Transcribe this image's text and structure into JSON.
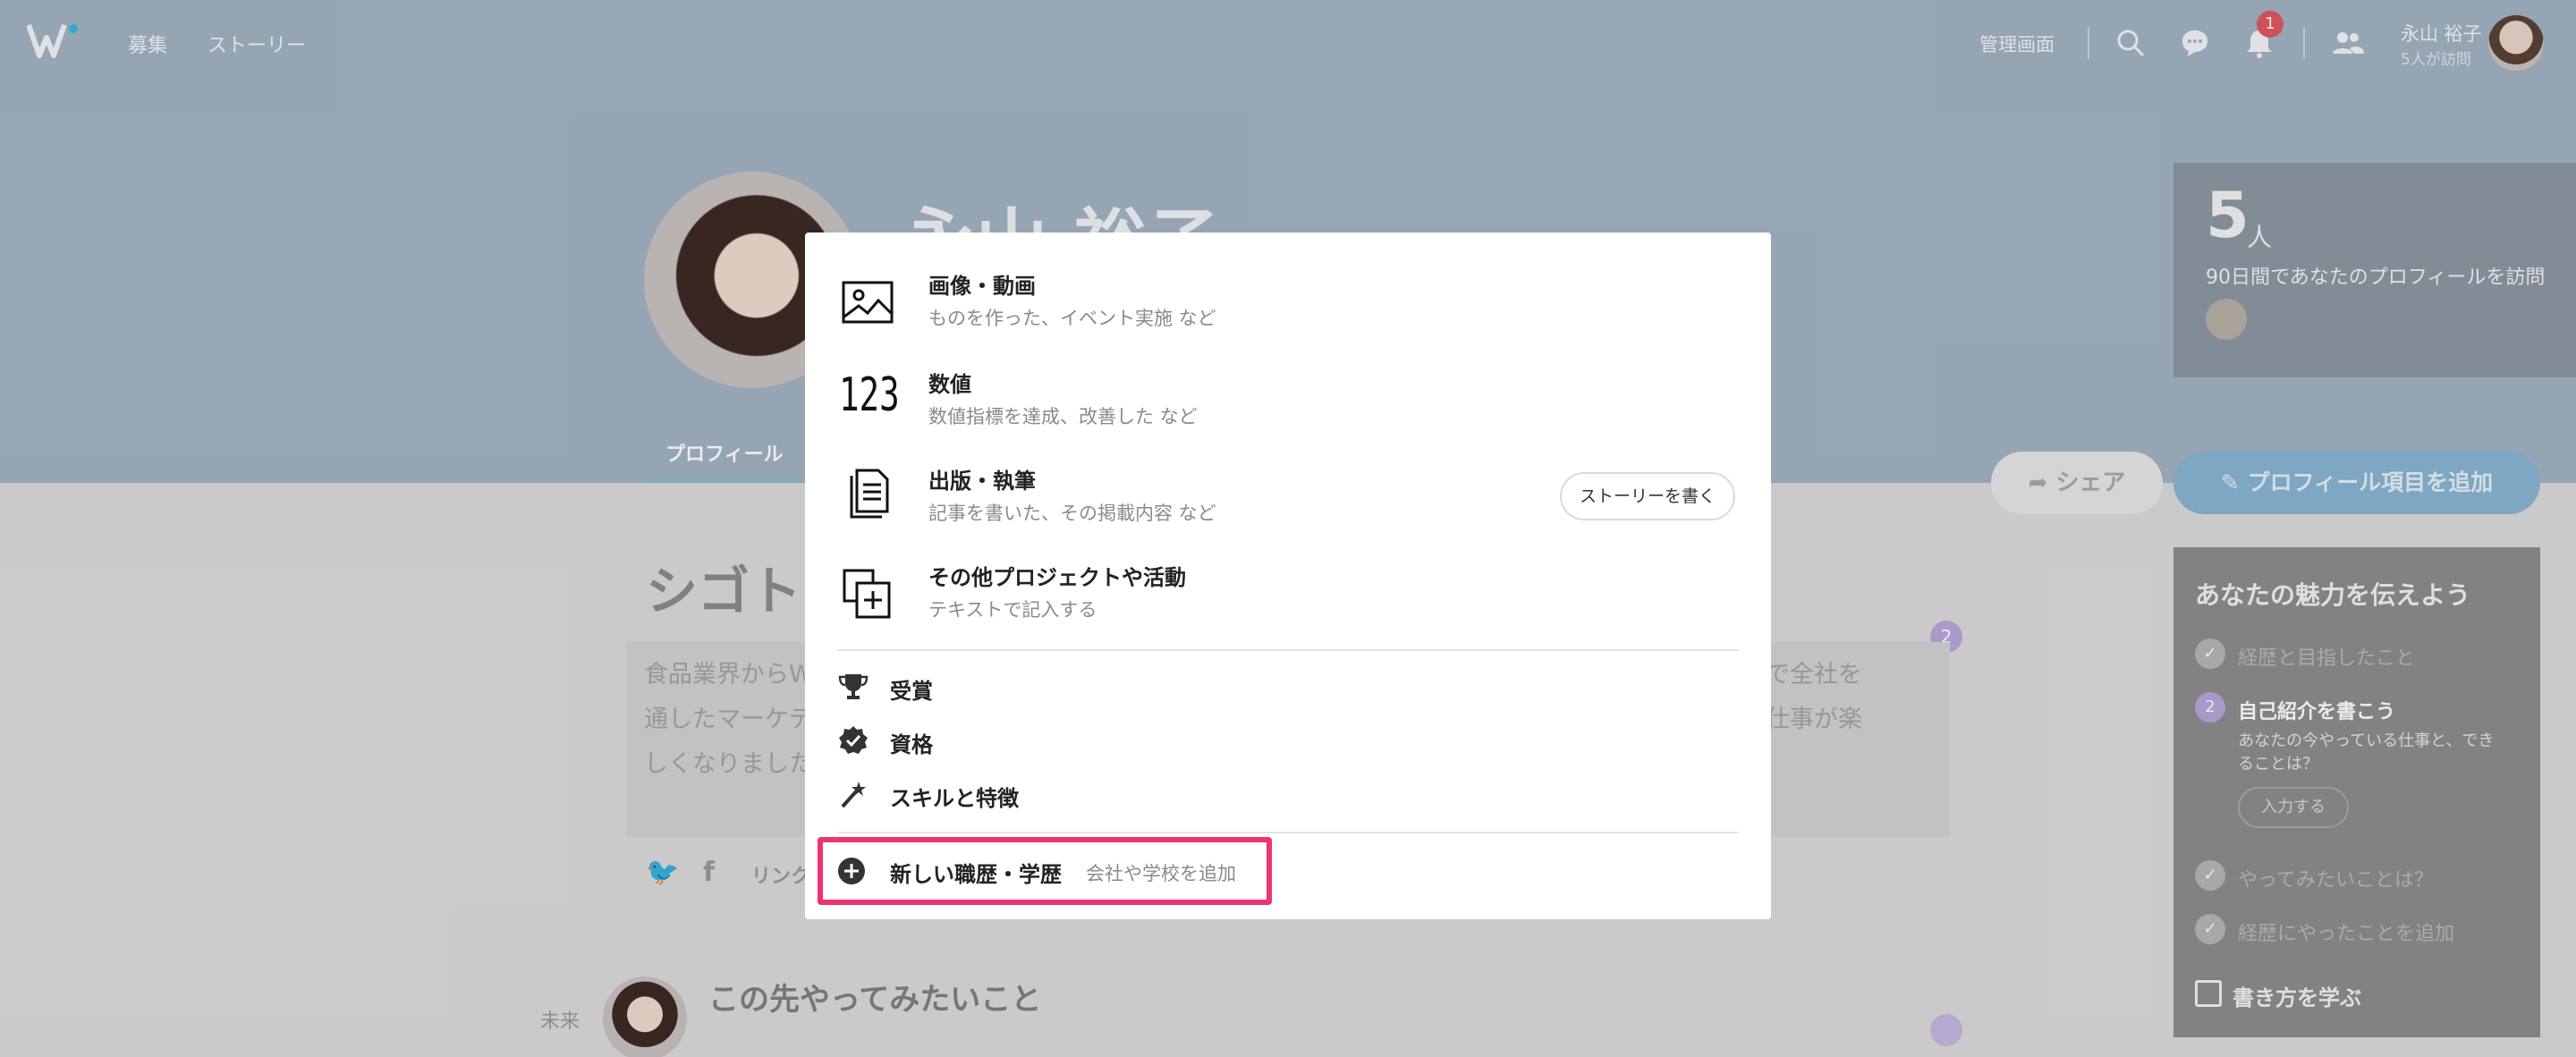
{
  "colors": {
    "accent_pink": "#ee3370",
    "hero_bg": "#a3b4c3",
    "notification": "#e0595e"
  },
  "topbar": {
    "nav": [
      "募集",
      "ストーリー"
    ],
    "admin": "管理画面",
    "notification_count": "1",
    "user_name": "永山 裕子",
    "user_visits": "5人が訪問",
    "icons": [
      "search-icon",
      "message-icon",
      "bell-icon",
      "people-icon"
    ]
  },
  "profile": {
    "name": "永山 裕子",
    "tab": "プロフィール"
  },
  "visits": {
    "count": "5",
    "unit": "人",
    "text": "90日間であなたのプロフィールを訪問"
  },
  "actions": {
    "share": "シェア",
    "add_item": "プロフィール項目を追加"
  },
  "appeal": {
    "title": "あなたの魅力を伝えよう",
    "steps": [
      {
        "label": "経歴と目指したこと",
        "done": true
      },
      {
        "label": "自己紹介を書こう",
        "num": "2",
        "current": true
      },
      {
        "label": "やってみたいことは？",
        "done": true
      },
      {
        "label": "経歴にやったことを追加",
        "done": true
      }
    ],
    "step_sub": "あなたの今やっている仕事と、できることは？",
    "step_button": "入力する",
    "howto": "書き方を学ぶ"
  },
  "main": {
    "shigoto": "シゴト",
    "intro_left": [
      "食品業界からW",
      "通したマーケテ",
      "しくなりました"
    ],
    "intro_right": [
      "会社で全社を",
      "らに仕事が楽"
    ],
    "badge": "2",
    "link": "リンク",
    "future_label": "未来",
    "future_title": "この先やってみたいこと"
  },
  "modal": {
    "items": [
      {
        "title": "画像・動画",
        "sub": "ものを作った、イベント実施 など",
        "icon": "image-icon"
      },
      {
        "title": "数値",
        "sub": "数値指標を達成、改善した など",
        "icon": "numbers-icon",
        "glyph": "123"
      },
      {
        "title": "出版・執筆",
        "sub": "記事を書いた、その掲載内容 など",
        "icon": "document-icon"
      },
      {
        "title": "その他プロジェクトや活動",
        "sub": "テキストで記入する",
        "icon": "add-copy-icon"
      }
    ],
    "story_button": "ストーリーを書く",
    "simple_items": [
      {
        "title": "受賞",
        "icon": "trophy-icon"
      },
      {
        "title": "資格",
        "icon": "certified-icon"
      },
      {
        "title": "スキルと特徴",
        "icon": "magic-wand-icon"
      }
    ],
    "new_career": {
      "title": "新しい職歴・学歴",
      "sub": "会社や学校を追加",
      "icon": "plus-circle-icon"
    }
  }
}
